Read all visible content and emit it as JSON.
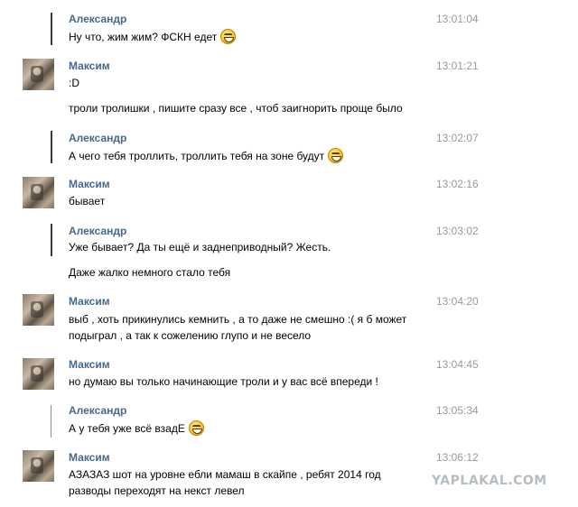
{
  "messages": [
    {
      "sender": "Александр",
      "time": "13:01:04",
      "lines": [
        "Ну что, жим жим? ФСКН едет"
      ],
      "emoji": "laughing-smiley-icon"
    },
    {
      "sender": "Максим",
      "time": "13:01:21",
      "lines": [
        ":D",
        "троли тролишки , пишите сразу все , чтоб заигнорить проще было"
      ]
    },
    {
      "sender": "Александр",
      "time": "13:02:07",
      "lines": [
        "А чего тебя троллить, троллить тебя на зоне будут"
      ],
      "emoji": "laughing-smiley-icon"
    },
    {
      "sender": "Максим",
      "time": "13:02:16",
      "lines": [
        "бывает"
      ]
    },
    {
      "sender": "Александр",
      "time": "13:03:02",
      "lines": [
        "Уже бывает? Да ты ещё и заднеприводный? Жесть.",
        "Даже жалко немного стало тебя"
      ]
    },
    {
      "sender": "Максим",
      "time": "13:04:20",
      "lines": [
        "выб , хоть прикинулись кемнить , а то даже не смешно :( я б может",
        "подыграл , а так к сожелению глупо и не весело"
      ]
    },
    {
      "sender": "Максим",
      "time": "13:04:45",
      "lines": [
        "но думаю вы только начинающие троли и у вас всё впереди !"
      ]
    },
    {
      "sender": "Александр",
      "time": "13:05:34",
      "lines": [
        "А у тебя уже всё взадЕ"
      ],
      "emoji": "laughing-smiley-icon"
    },
    {
      "sender": "Максим",
      "time": "13:06:12",
      "lines": [
        "АЗАЗАЗ шот на уровне ебли мамаш в скайпе , ребят 2014 год",
        "разводы переходят на некст левел"
      ]
    }
  ],
  "watermark": "YAPLAKAL.COM"
}
